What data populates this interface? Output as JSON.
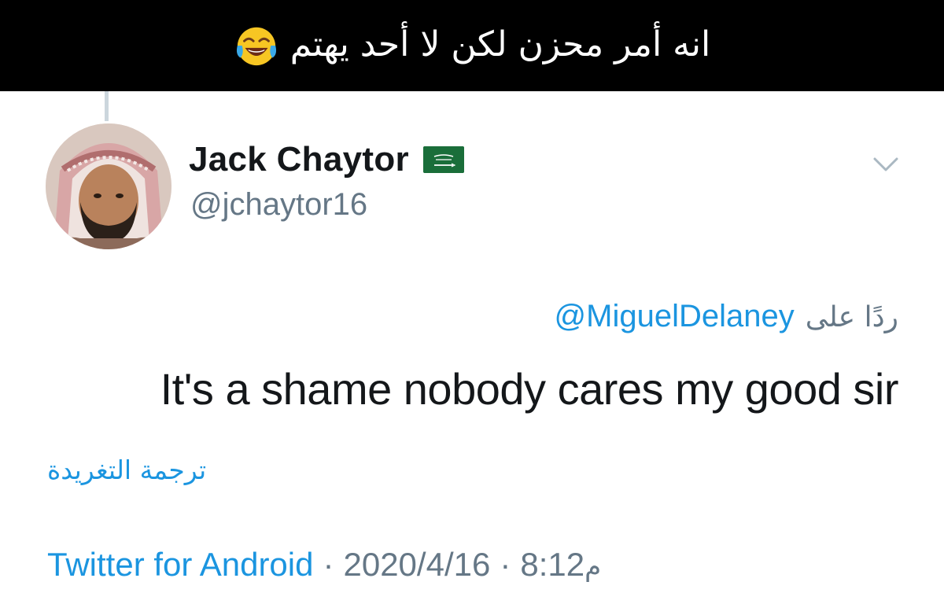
{
  "caption": {
    "text": "انه أمر محزن لكن لا أحد يهتم",
    "emoji": "face-with-tears-of-joy-icon"
  },
  "tweet": {
    "display_name": "Jack Chaytor",
    "handle": "@jchaytor16",
    "flag_icon": "saudi-flag-icon",
    "reply_prefix": "ردًا على",
    "reply_to": "@MiguelDelaney",
    "text": "It's a shame nobody cares my good sir",
    "translate_label": "ترجمة التغريدة",
    "source": "Twitter for Android",
    "separator": "·",
    "date": "2020/4/16",
    "time": "8:12",
    "ampm": "م"
  },
  "colors": {
    "link": "#1b95e0",
    "secondary_text": "#657786",
    "primary_text": "#14171a",
    "caption_bg": "#000000",
    "caption_text": "#ffffff",
    "flag_green": "#1a6e3a"
  }
}
